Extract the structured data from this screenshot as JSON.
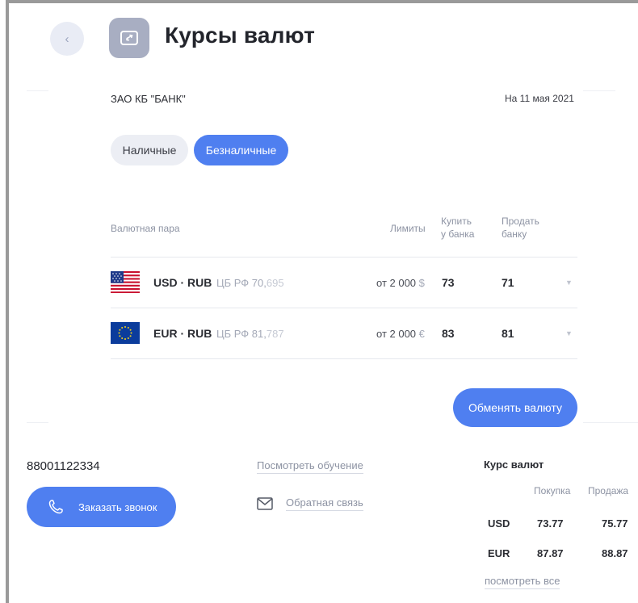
{
  "header": {
    "back_icon": "chevron-left-icon",
    "title_icon": "currency-exchange-icon",
    "title": "Курсы валют"
  },
  "info": {
    "bank": "ЗАО КБ \"БАНК\"",
    "date": "На 11 мая 2021"
  },
  "tabs": [
    {
      "label": "Наличные",
      "active": false
    },
    {
      "label": "Безналичные",
      "active": true
    }
  ],
  "table": {
    "headers": {
      "pair": "Валютная пара",
      "limits": "Лимиты",
      "buy_line1": "Купить",
      "buy_line2": "у банка",
      "sell_line1": "Продать",
      "sell_line2": "банку"
    },
    "rows": [
      {
        "flag": "us-flag-icon",
        "pair": "USD · RUB",
        "cb_label": "ЦБ РФ",
        "cb_int": "70,",
        "cb_frac": "695",
        "limit": "от 2 000",
        "limit_cur": "$",
        "buy": "73",
        "sell": "71"
      },
      {
        "flag": "eu-flag-icon",
        "pair": "EUR · RUB",
        "cb_label": "ЦБ РФ",
        "cb_int": "81,",
        "cb_frac": "787",
        "limit": "от 2 000",
        "limit_cur": "€",
        "buy": "83",
        "sell": "81"
      }
    ]
  },
  "exchange_button": "Обменять валюту",
  "footer": {
    "phone": "88001122334",
    "call_button": "Заказать звонок",
    "education_link": "Посмотреть обучение",
    "feedback_link": "Обратная связь",
    "rates": {
      "title": "Курс валют",
      "col_buy": "Покупка",
      "col_sell": "Продажа",
      "rows": [
        {
          "code": "USD",
          "buy": "73.77",
          "sell": "75.77"
        },
        {
          "code": "EUR",
          "buy": "87.87",
          "sell": "88.87"
        }
      ],
      "see_all": "посмотреть все"
    }
  },
  "colors": {
    "accent": "#4f7ff0",
    "muted": "#8d93a3",
    "text": "#2b2d33"
  }
}
